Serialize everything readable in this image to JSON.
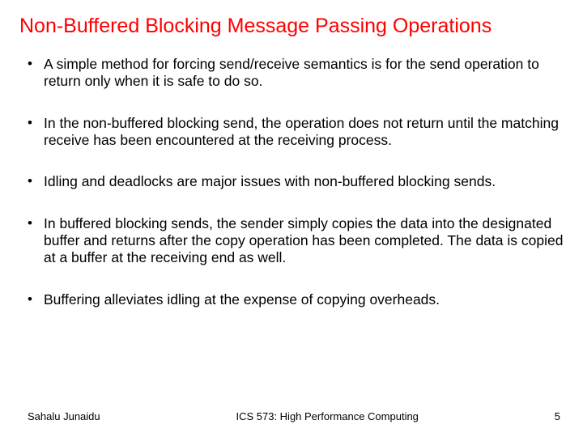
{
  "title": "Non-Buffered Blocking Message Passing Operations",
  "bullets": [
    "A simple method for forcing send/receive semantics is for the send operation to return only when it is safe to do so.",
    "In the non-buffered blocking send, the operation does not return until the matching receive has been encountered at the receiving process.",
    "Idling and deadlocks are major issues with non-buffered blocking sends.",
    "In buffered blocking sends, the sender simply copies the data into the designated buffer and returns after the copy operation has been completed. The data is copied at a buffer at the receiving end as well.",
    "Buffering alleviates idling at the expense of copying overheads."
  ],
  "footer": {
    "author": "Sahalu Junaidu",
    "course": "ICS 573: High Performance Computing",
    "page": "5"
  }
}
